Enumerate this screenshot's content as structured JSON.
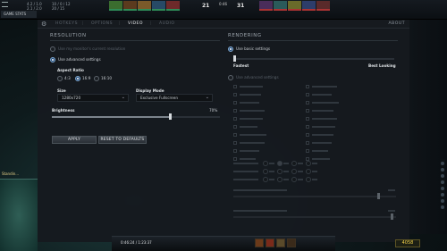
{
  "hud": {
    "stats_left": [
      "4.2 / 1.0",
      "2.1 / 2.0"
    ],
    "stats_mid": [
      "10 / 0 / 12",
      "20 / 15"
    ],
    "score_radiant": "21",
    "score_dire": "31",
    "clock": "0:46",
    "game_stats_label": "GAME STATS",
    "hero_tag": "Standin...",
    "timer_text": "0:46:24 / 1:23:37",
    "gold": "4058",
    "radiant_heroes": [
      "#3b6d2f",
      "#5b3a1e",
      "#7a5a2a",
      "#274a66",
      "#6d2a2a"
    ],
    "dire_heroes": [
      "#4a2d5a",
      "#2a5a5a",
      "#6a6a2a",
      "#2d3d6a",
      "#5a2a2a"
    ]
  },
  "tabs": [
    {
      "label": "HOTKEYS",
      "active": false
    },
    {
      "label": "OPTIONS",
      "active": false
    },
    {
      "label": "VIDEO",
      "active": true
    },
    {
      "label": "AUDIO",
      "active": false
    }
  ],
  "about_label": "ABOUT",
  "resolution": {
    "title": "RESOLUTION",
    "use_monitor_label": "Use my monitor's current resolution",
    "use_advanced_label": "Use advanced settings",
    "aspect_ratio_label": "Aspect Ratio",
    "aspect_options": [
      "4:3",
      "16:9",
      "16:10"
    ],
    "aspect_selected": "16:9",
    "size_label": "Size",
    "size_value": "1280x720",
    "display_mode_label": "Display Mode",
    "display_mode_value": "Exclusive Fullscreen",
    "brightness_label": "Brightness",
    "brightness_value": "70%",
    "brightness_level": 0.7,
    "apply_label": "APPLY",
    "reset_label": "RESET TO DEFAULTS"
  },
  "rendering": {
    "title": "RENDERING",
    "use_basic_label": "Use basic settings",
    "fastest_label": "Fastest",
    "best_looking_label": "Best Looking",
    "quality_level": 0.0,
    "use_advanced_label": "Use advanced settings",
    "advanced_level_a": 0.89,
    "advanced_level_b": 0.97
  },
  "colors": {
    "accent": "#2a4f7a",
    "gold": "#f2d24a"
  }
}
